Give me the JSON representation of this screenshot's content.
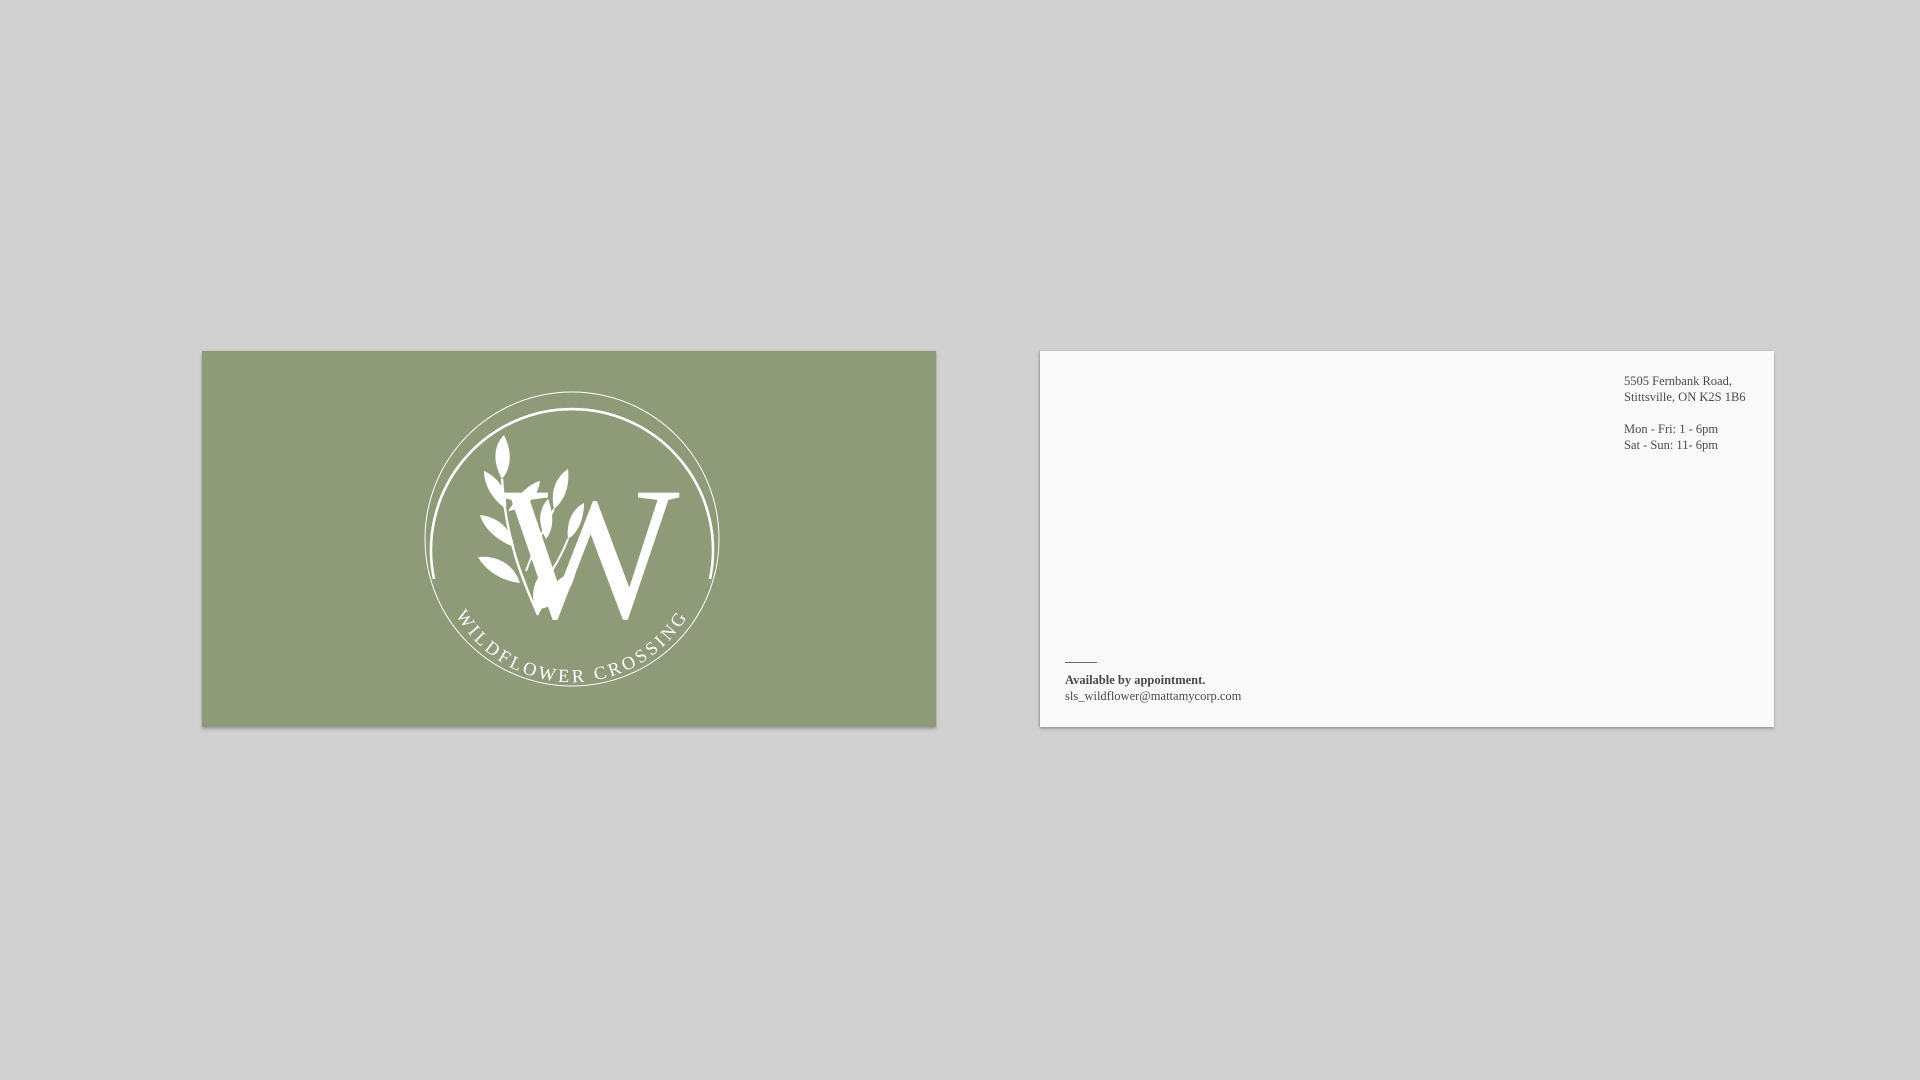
{
  "front": {
    "brand_name": "WILDFLOWER CROSSING",
    "monogram": "W",
    "colors": {
      "card_background": "#8e9a78",
      "logo": "#ffffff"
    },
    "logo_icon": "leaf-sprig-monogram-seal"
  },
  "back": {
    "address_line_1": "5505 Fernbank Road,",
    "address_line_2": "Stittsville, ON K2S 1B6",
    "hours_weekday": "Mon - Fri: 1 - 6pm",
    "hours_weekend": "Sat - Sun: 11- 6pm",
    "availability": "Available by appointment.",
    "email": "sls_wildflower@mattamycorp.com",
    "colors": {
      "card_background": "#f9f9f9",
      "text": "#4a4a4a"
    }
  },
  "colors": {
    "background": "#d1d1d1"
  }
}
